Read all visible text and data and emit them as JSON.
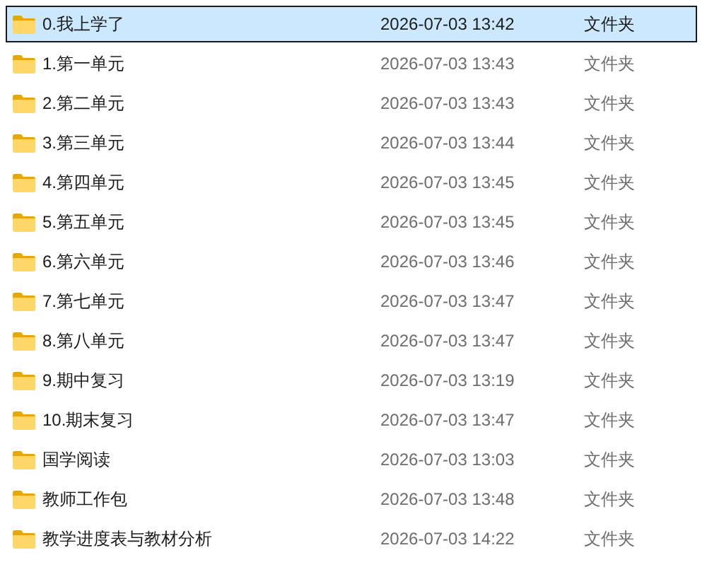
{
  "files": [
    {
      "name": "0.我上学了",
      "modified": "2026-07-03 13:42",
      "type": "文件夹",
      "selected": true
    },
    {
      "name": "1.第一单元",
      "modified": "2026-07-03 13:43",
      "type": "文件夹",
      "selected": false
    },
    {
      "name": "2.第二单元",
      "modified": "2026-07-03 13:43",
      "type": "文件夹",
      "selected": false
    },
    {
      "name": "3.第三单元",
      "modified": "2026-07-03 13:44",
      "type": "文件夹",
      "selected": false
    },
    {
      "name": "4.第四单元",
      "modified": "2026-07-03 13:45",
      "type": "文件夹",
      "selected": false
    },
    {
      "name": "5.第五单元",
      "modified": "2026-07-03 13:45",
      "type": "文件夹",
      "selected": false
    },
    {
      "name": "6.第六单元",
      "modified": "2026-07-03 13:46",
      "type": "文件夹",
      "selected": false
    },
    {
      "name": "7.第七单元",
      "modified": "2026-07-03 13:47",
      "type": "文件夹",
      "selected": false
    },
    {
      "name": "8.第八单元",
      "modified": "2026-07-03 13:47",
      "type": "文件夹",
      "selected": false
    },
    {
      "name": "9.期中复习",
      "modified": "2026-07-03 13:19",
      "type": "文件夹",
      "selected": false
    },
    {
      "name": "10.期末复习",
      "modified": "2026-07-03 13:47",
      "type": "文件夹",
      "selected": false
    },
    {
      "name": "国学阅读",
      "modified": "2026-07-03 13:03",
      "type": "文件夹",
      "selected": false
    },
    {
      "name": "教师工作包",
      "modified": "2026-07-03 13:48",
      "type": "文件夹",
      "selected": false
    },
    {
      "name": "教学进度表与教材分析",
      "modified": "2026-07-03 14:22",
      "type": "文件夹",
      "selected": false
    }
  ]
}
